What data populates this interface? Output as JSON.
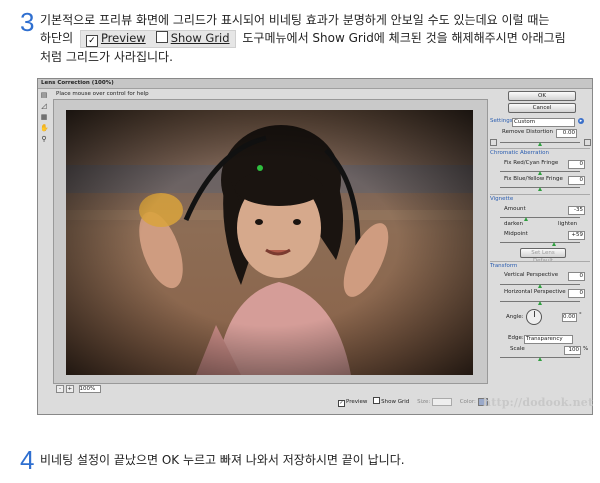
{
  "step3": {
    "number": "3",
    "line1": "기본적으로 프리뷰 화면에 그리드가 표시되어 비네팅 효과가 분명하게 안보일 수도 있는데요 이럴 때는",
    "line2_before": "하단의",
    "preview_label": "Preview",
    "show_grid_label": "Show Grid",
    "line2_after": "도구메뉴에서 Show Grid에 체크된 것을 해제해주시면 아래그림",
    "line3": "처럼 그리드가 사라집니다."
  },
  "dialog": {
    "title": "Lens Correction (100%)",
    "hint": "Place mouse over control for help",
    "tools": [
      "remove-distortion-tool",
      "straighten-tool",
      "move-grid-tool",
      "hand-tool",
      "zoom-tool"
    ],
    "ok_label": "OK",
    "cancel_label": "Cancel",
    "settings_label": "Settings:",
    "settings_value": "Custom",
    "remove_distortion_label": "Remove Distortion",
    "remove_distortion_value": "0.00",
    "chromatic_section": "Chromatic Aberration",
    "fix_red_cyan_label": "Fix Red/Cyan Fringe",
    "fix_red_cyan_value": "0",
    "fix_blue_yellow_label": "Fix Blue/Yellow Fringe",
    "fix_blue_yellow_value": "0",
    "vignette_section": "Vignette",
    "amount_label": "Amount",
    "amount_value": "-35",
    "darken_label": "darken",
    "lighten_label": "lighten",
    "midpoint_label": "Midpoint",
    "midpoint_value": "+59",
    "set_lens_default_label": "Set Lens Default",
    "transform_section": "Transform",
    "vertical_perspective_label": "Vertical Perspective",
    "vertical_perspective_value": "0",
    "horizontal_perspective_label": "Horizontal Perspective",
    "horizontal_perspective_value": "0",
    "angle_label": "Angle:",
    "angle_value": "0.00",
    "angle_unit": "°",
    "edge_label": "Edge:",
    "edge_value": "Transparency",
    "scale_label": "Scale",
    "scale_value": "100",
    "scale_unit": "%",
    "zoom_minus": "-",
    "zoom_plus": "+",
    "zoom_value": "100%",
    "preview_label": "Preview",
    "show_grid_label": "Show Grid",
    "size_label": "Size:",
    "color_label": "Color:",
    "preview_checked": true,
    "show_grid_checked": false,
    "grid_color": "#9aa9c9"
  },
  "watermark": "http://dodook.net",
  "step4": {
    "number": "4",
    "text": "비네팅 설정이 끝났으면 OK 누르고 빠져 나와서 저장하시면 끝이 납니다."
  },
  "colors": {
    "step_number": "#2f6fd0",
    "slider_thumb": "#2f9f3f",
    "section_label": "#2a5db0"
  }
}
